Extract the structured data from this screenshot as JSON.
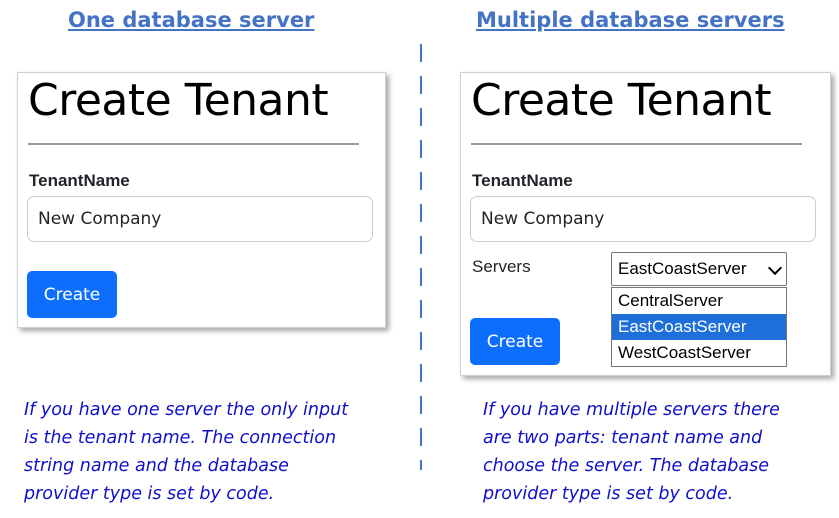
{
  "headings": {
    "left": "One database server",
    "right": "Multiple database servers"
  },
  "colors": {
    "heading": "#4472c4",
    "primary_button": "#0d6efd",
    "note_text": "#1010c8",
    "selected_option": "#1e6fd9"
  },
  "left_form": {
    "title": "Create Tenant",
    "tenant_label": "TenantName",
    "tenant_value": "New Company",
    "create_label": "Create"
  },
  "right_form": {
    "title": "Create Tenant",
    "tenant_label": "TenantName",
    "tenant_value": "New Company",
    "servers_label": "Servers",
    "servers_selected": "EastCoastServer",
    "server_options": [
      "CentralServer",
      "EastCoastServer",
      "WestCoastServer"
    ],
    "create_label": "Create"
  },
  "notes": {
    "left": [
      "If you have one server the only input",
      "is the tenant name. The connection",
      "string name and the database",
      "provider type is set by code."
    ],
    "right": [
      "If you have multiple servers there",
      "are two parts: tenant name and",
      "choose the server. The database",
      "provider type is set by code."
    ]
  }
}
